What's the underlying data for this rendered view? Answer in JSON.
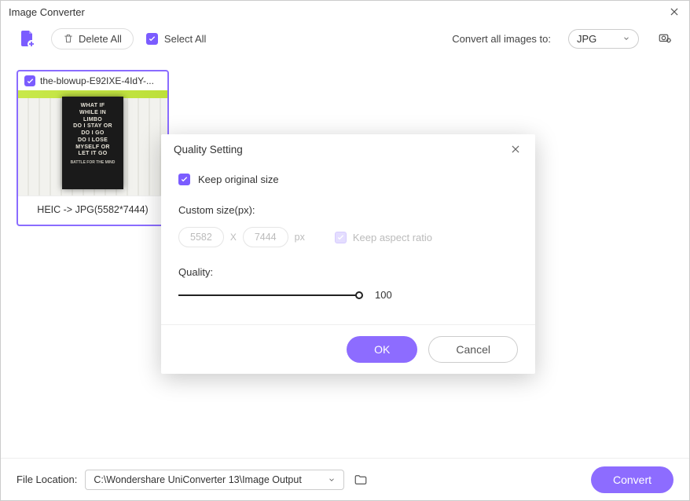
{
  "window": {
    "title": "Image Converter"
  },
  "toolbar": {
    "delete_all_label": "Delete All",
    "select_all_label": "Select All",
    "select_all_checked": true,
    "convert_all_label": "Convert all images to:",
    "output_format": "JPG"
  },
  "thumbnail": {
    "filename": "the-blowup-E92IXE-4IdY-...",
    "selected": true,
    "caption": "HEIC -> JPG(5582*7444)",
    "poster_lines": [
      "WHAT IF",
      "WHILE IN",
      "LIMBO",
      "DO I STAY OR",
      "DO I GO",
      "DO I LOSE",
      "MYSELF OR",
      "LET IT GO"
    ]
  },
  "modal": {
    "title": "Quality Setting",
    "keep_original_label": "Keep original size",
    "keep_original_checked": true,
    "custom_size_label": "Custom size(px):",
    "width": "5582",
    "height": "7444",
    "unit": "px",
    "x_label": "X",
    "aspect_label": "Keep aspect ratio",
    "quality_label": "Quality:",
    "quality_value": "100",
    "ok_label": "OK",
    "cancel_label": "Cancel"
  },
  "footer": {
    "location_label": "File Location:",
    "path": "C:\\Wondershare UniConverter 13\\Image Output",
    "convert_label": "Convert"
  }
}
